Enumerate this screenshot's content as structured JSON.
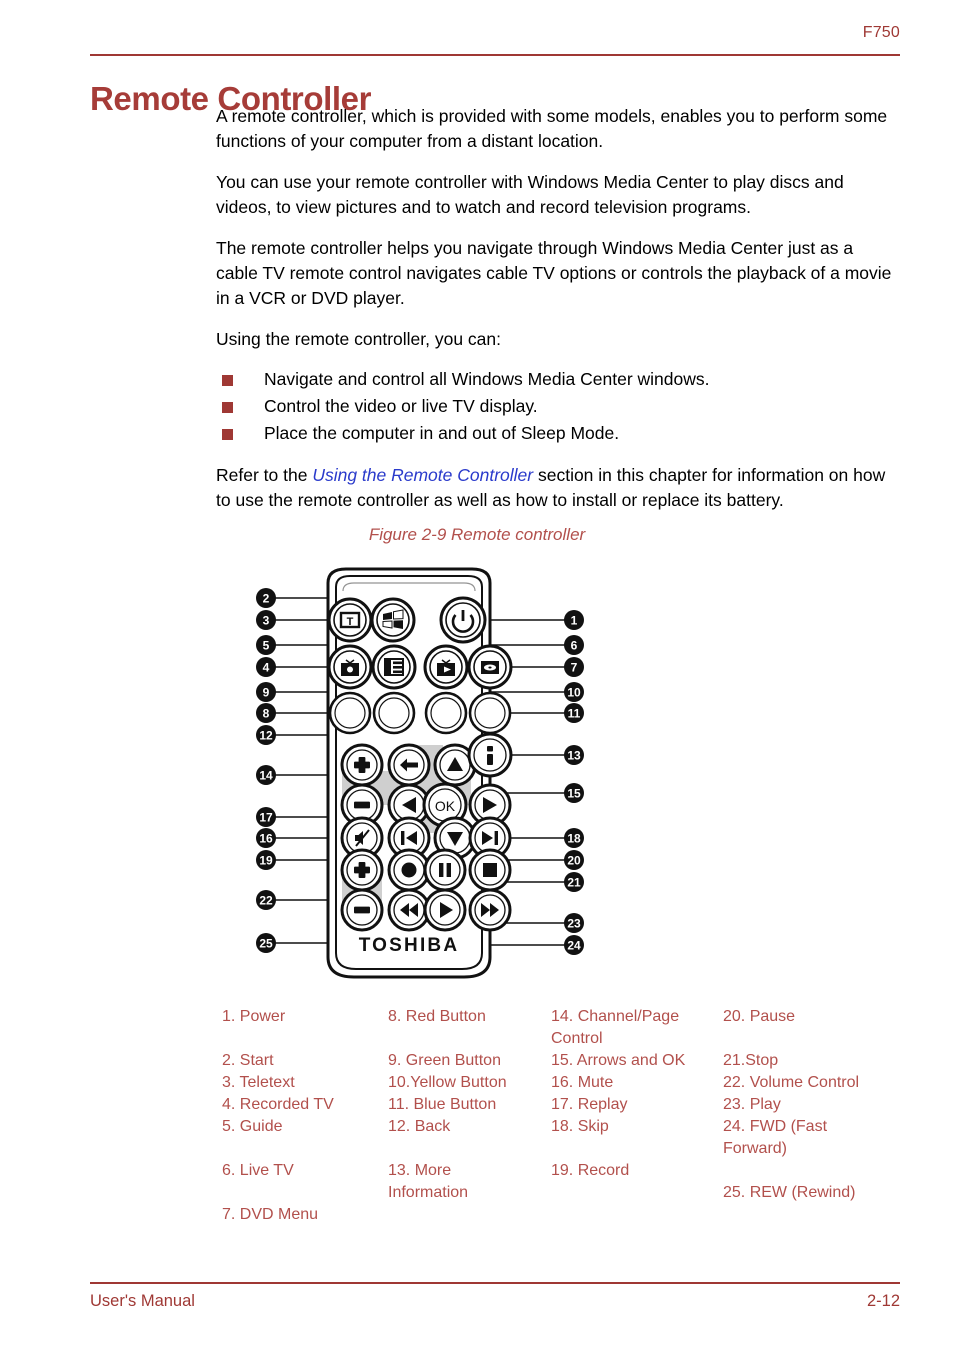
{
  "header": {
    "model": "F750"
  },
  "title": "Remote Controller",
  "paragraphs": {
    "p1": "A remote controller, which is provided with some models, enables you to perform some functions of your computer from a distant location.",
    "p2": "You can use your remote controller with Windows Media Center to play discs and videos, to view pictures and to watch and record television programs.",
    "p3": "The remote controller helps you navigate through Windows Media Center just as a cable TV remote control navigates cable TV options or controls the playback of a movie in a VCR or DVD player.",
    "p4": "Using the remote controller, you can:",
    "p5_before": "Refer to the ",
    "p5_link": "Using the Remote Controller",
    "p5_after": " section in this chapter for information on how to use the remote controller as well as how to install or replace its battery."
  },
  "bullets": [
    "Navigate and control all Windows Media Center windows.",
    "Control the video or live TV display.",
    "Place the computer in and out of Sleep Mode."
  ],
  "figure": {
    "caption": "Figure 2-9 Remote controller",
    "brand": "TOSHIBA",
    "ok_label": "OK",
    "callouts_left": [
      "2",
      "3",
      "5",
      "4",
      "9",
      "8",
      "12",
      "14",
      "17",
      "16",
      "19",
      "22",
      "25"
    ],
    "callouts_right": [
      "1",
      "6",
      "7",
      "10",
      "11",
      "13",
      "15",
      "18",
      "20",
      "21",
      "23",
      "24"
    ]
  },
  "legend": {
    "col1": [
      "1. Power",
      "",
      "2. Start",
      "3. Teletext",
      "4. Recorded TV",
      "5. Guide",
      "",
      "6. Live TV",
      "",
      "7. DVD Menu"
    ],
    "col2": [
      "8. Red Button",
      "",
      "9. Green Button",
      "10.Yellow Button",
      "11. Blue Button",
      "12. Back",
      "",
      "13. More",
      "Information"
    ],
    "col3": [
      "14. Channel/Page",
      "Control",
      "15. Arrows and OK",
      "16. Mute",
      "17. Replay",
      "18. Skip",
      "",
      "19. Record"
    ],
    "col4": [
      "20. Pause",
      "",
      "21.Stop",
      "22. Volume Control",
      "23. Play",
      "24. FWD (Fast",
      "Forward)",
      "",
      "25. REW (Rewind)"
    ]
  },
  "footer": {
    "left": "User's Manual",
    "right": "2-12"
  },
  "colors": {
    "accent_red": "#9f3834",
    "title_red": "#a63c38",
    "legend_red": "#b2504c",
    "link_blue": "#2a3acb"
  }
}
